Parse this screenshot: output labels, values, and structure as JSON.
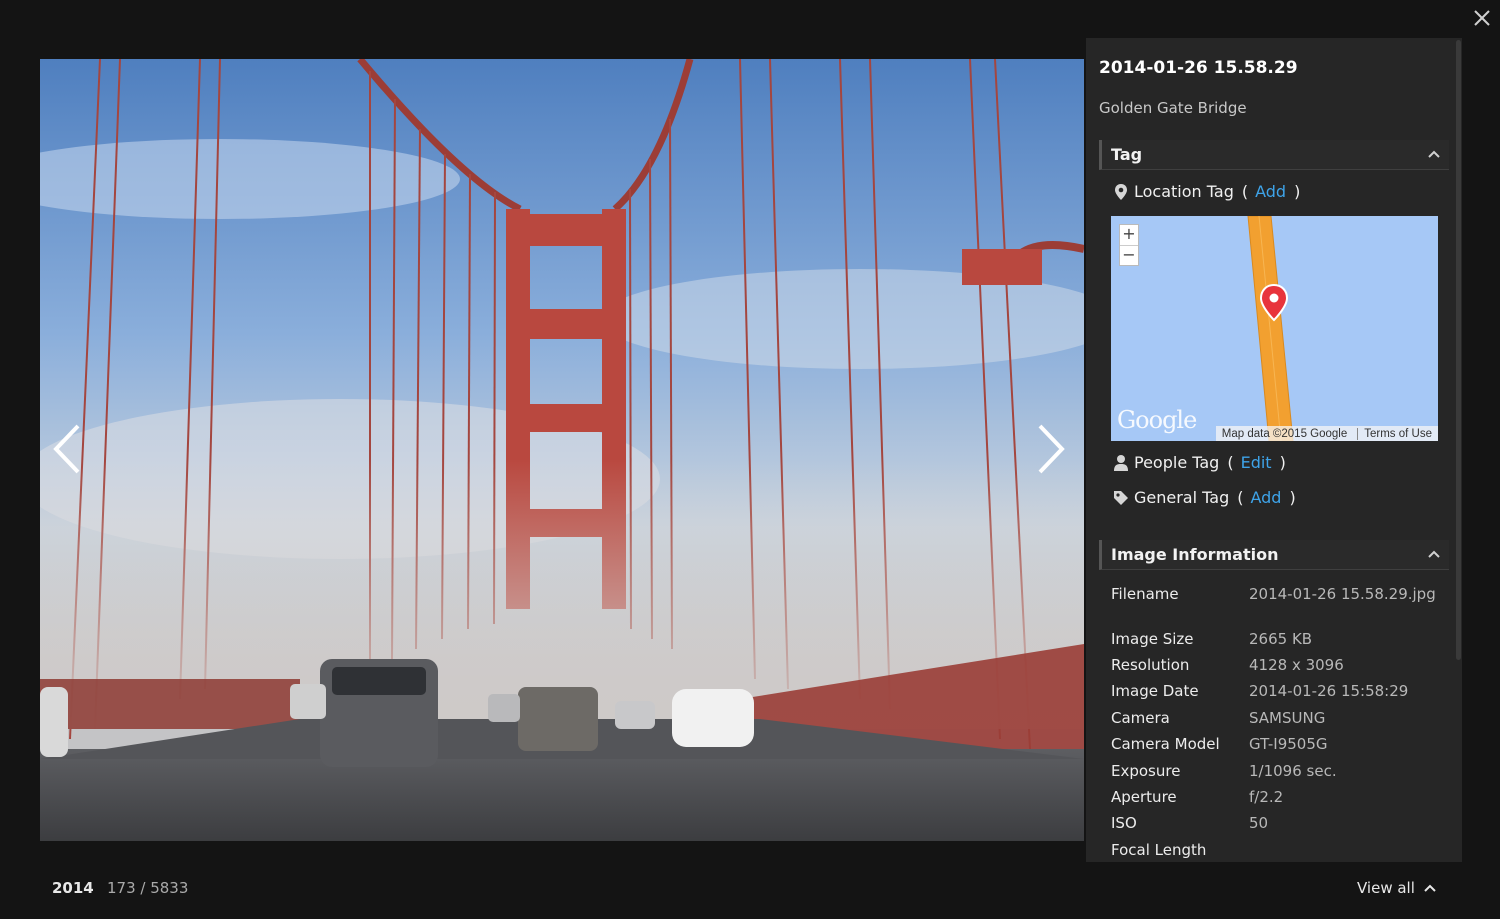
{
  "photo": {
    "title": "2014-01-26 15.58.29",
    "description": "Golden Gate Bridge"
  },
  "tag_section": {
    "header": "Tag",
    "location": {
      "label": "Location Tag",
      "open": "(",
      "action": "Add",
      "close": ")"
    },
    "people": {
      "label": "People Tag",
      "open": "(",
      "action": "Edit",
      "close": ")"
    },
    "general": {
      "label": "General Tag",
      "open": "(",
      "action": "Add",
      "close": ")"
    }
  },
  "map": {
    "zoom_in": "+",
    "zoom_out": "−",
    "logo": "Google",
    "attribution": "Map data ©2015 Google",
    "terms": "Terms of Use",
    "water_color": "#a6c8f6",
    "road_color": "#f2a030",
    "marker_color": "#e8343c"
  },
  "info_section": {
    "header": "Image Information",
    "rows": [
      {
        "key": "Filename",
        "value": "2014-01-26 15.58.29.jpg"
      },
      {
        "key": "Image Size",
        "value": "2665 KB"
      },
      {
        "key": "Resolution",
        "value": "4128 x 3096"
      },
      {
        "key": "Image Date",
        "value": "2014-01-26 15:58:29"
      },
      {
        "key": "Camera",
        "value": "SAMSUNG"
      },
      {
        "key": "Camera Model",
        "value": "GT-I9505G"
      },
      {
        "key": "Exposure",
        "value": "1/1096 sec."
      },
      {
        "key": "Aperture",
        "value": "f/2.2"
      },
      {
        "key": "ISO",
        "value": "50"
      },
      {
        "key": "Focal Length",
        "value": ""
      }
    ]
  },
  "footer": {
    "year": "2014",
    "position": "173 / 5833",
    "view_all": "View all"
  },
  "colors": {
    "background": "#141414",
    "panel": "#262626",
    "link": "#3ea3e8",
    "bridge": "#b9483f"
  },
  "icons": {
    "close": "close-icon",
    "prev": "chevron-left-icon",
    "next": "chevron-right-icon",
    "location": "map-pin-icon",
    "people": "person-icon",
    "general": "tag-icon",
    "collapse": "chevron-up-icon"
  }
}
